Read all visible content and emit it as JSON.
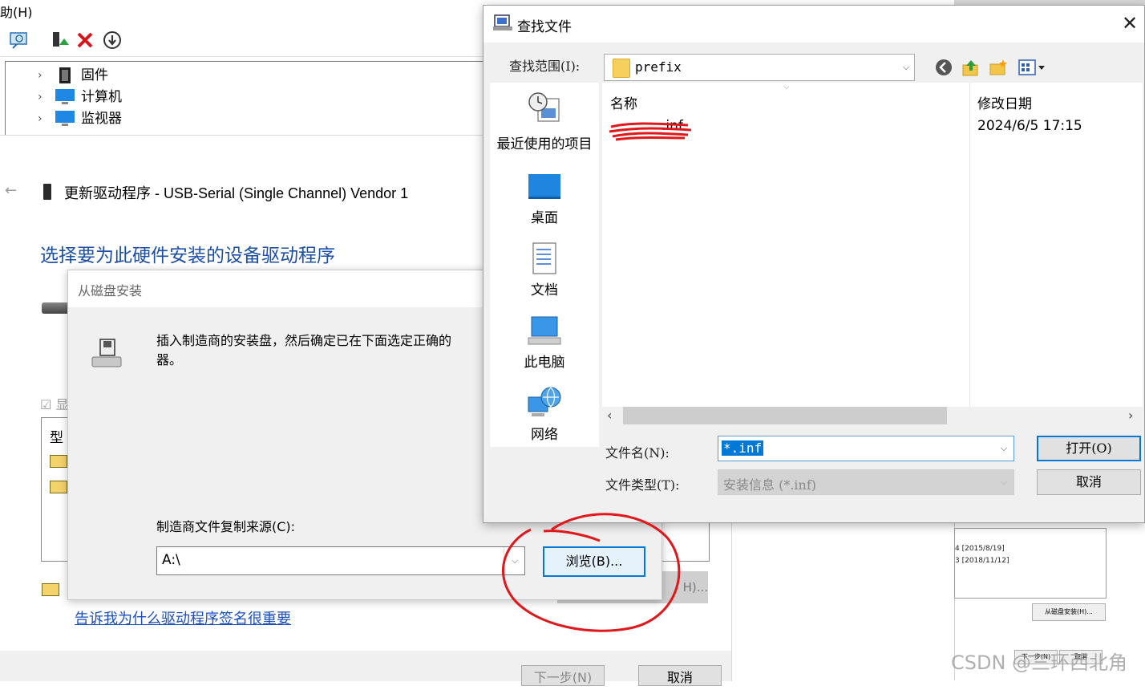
{
  "device_manager": {
    "menu_fragment": "助(H)",
    "tree": [
      {
        "label": "固件"
      },
      {
        "label": "计算机"
      },
      {
        "label": "监视器"
      }
    ]
  },
  "wizard": {
    "title": "更新驱动程序 - USB-Serial (Single Channel) Vendor 1",
    "heading": "选择要为此硬件安装的设备驱动程序",
    "checkbox_fragment": "显",
    "list_header_fragment": "型",
    "disk_button_fragment": "H)...",
    "signature_link": "告诉我为什么驱动程序签名很重要",
    "next_button": "下一步(N)",
    "cancel_button": "取消"
  },
  "disk_dialog": {
    "title": "从磁盘安装",
    "message": "插入制造商的安装盘，然后确定已在下面选定正确的器。",
    "message_line1": "插入制造商的安装盘，然后确定已在下面选定正确的",
    "message_line2": "器。",
    "source_label": "制造商文件复制来源(C):",
    "source_value": "A:\\",
    "browse_button": "浏览(B)..."
  },
  "find_dialog": {
    "title": "查找文件",
    "look_in_label": "查找范围(I):",
    "look_in_value": "prefix",
    "sidebar": [
      {
        "label": "最近使用的项目",
        "icon": "recent-icon"
      },
      {
        "label": "桌面",
        "icon": "desktop-icon"
      },
      {
        "label": "文档",
        "icon": "documents-icon"
      },
      {
        "label": "此电脑",
        "icon": "this-pc-icon"
      },
      {
        "label": "网络",
        "icon": "network-icon"
      }
    ],
    "columns": {
      "name": "名称",
      "modified": "修改日期"
    },
    "files": [
      {
        "name": ".inf",
        "modified": "2024/6/5 17:15"
      }
    ],
    "filename_label": "文件名(N):",
    "filename_value": "*.inf",
    "filetype_label": "文件类型(T):",
    "filetype_value": "安装信息 (*.inf)",
    "open_button": "打开(O)",
    "cancel_button": "取消"
  },
  "right_window": {
    "list_items": [
      "4 [2015/8/19]",
      "3 [2018/11/12]"
    ],
    "disk_button": "从磁盘安装(H)...",
    "next_button": "下一步(N)",
    "cancel_button": "取消"
  },
  "watermark": "CSDN @三环西北角",
  "colors": {
    "accent": "#0078d7",
    "heading_blue": "#1c4fa6",
    "link_blue": "#1b4fbf",
    "annotation_red": "#e0171b"
  }
}
